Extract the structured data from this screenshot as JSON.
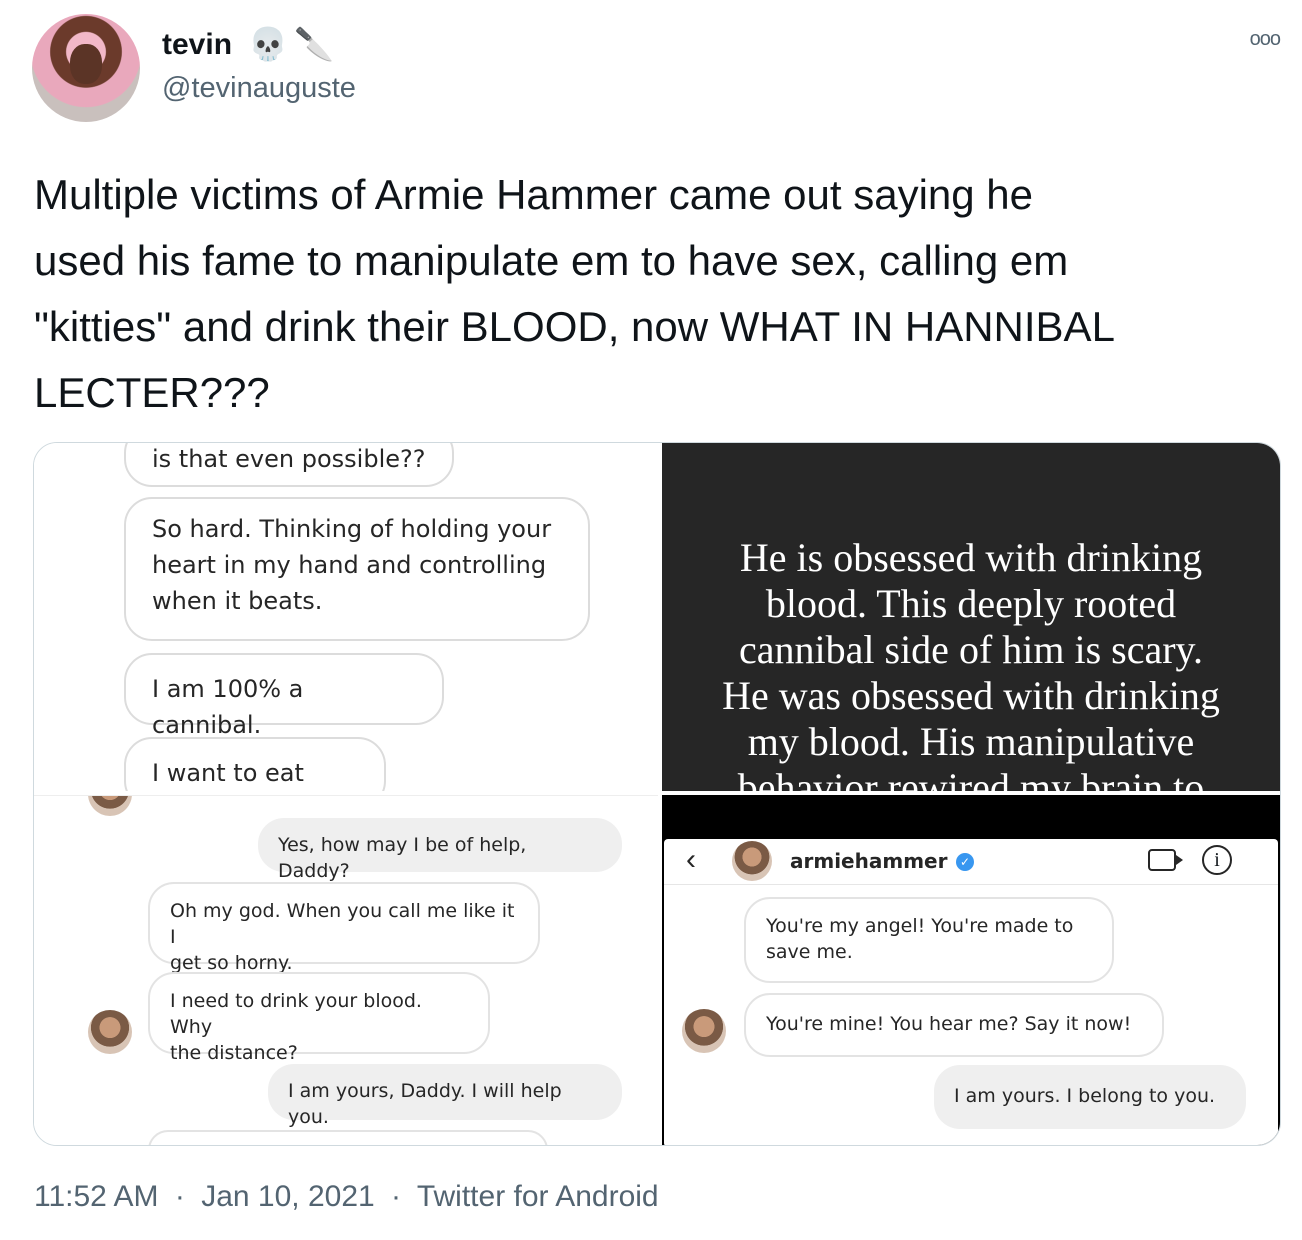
{
  "author": {
    "display_name": "tevin",
    "emoji_1": "💀",
    "emoji_2": "🔪",
    "handle": "@tevinauguste",
    "more_icon": "ooo"
  },
  "tweet": {
    "text": "Multiple victims of Armie Hammer came out saying he\nused his fame to manipulate em to have sex, calling em\n\"kitties\" and drink their BLOOD, now WHAT IN HANNIBAL\nLECTER???"
  },
  "media": {
    "panel1": {
      "bubbles": [
        "is that even possible??",
        "So hard. Thinking of holding your\nheart in my hand and controlling\nwhen it beats.",
        "I am 100% a cannibal.",
        "I want to eat you."
      ]
    },
    "panel2": {
      "text": "He is obsessed with drinking\nblood.  This deeply rooted\ncannibal side of him is scary.\nHe was obsessed with drinking\nmy blood.  His manipulative\nbehavior rewired my brain to"
    },
    "panel3": {
      "bubbles": [
        "Yes, how may I be of help, Daddy?",
        "Oh my god. When you call me like it I\nget so horny.",
        "I need to drink your blood. Why\nthe distance?",
        "I am yours, Daddy. I will help you."
      ]
    },
    "panel4": {
      "back_icon": "‹",
      "username": "armiehammer",
      "verified_icon": "✓",
      "info_icon": "i",
      "bubbles": [
        "You're my angel! You're made to\nsave me.",
        "You're mine! You hear me? Say it now!",
        "I am yours. I belong to you."
      ]
    }
  },
  "footer": {
    "time": "11:52 AM",
    "separator": "·",
    "date": "Jan 10, 2021",
    "source": "Twitter for Android"
  }
}
